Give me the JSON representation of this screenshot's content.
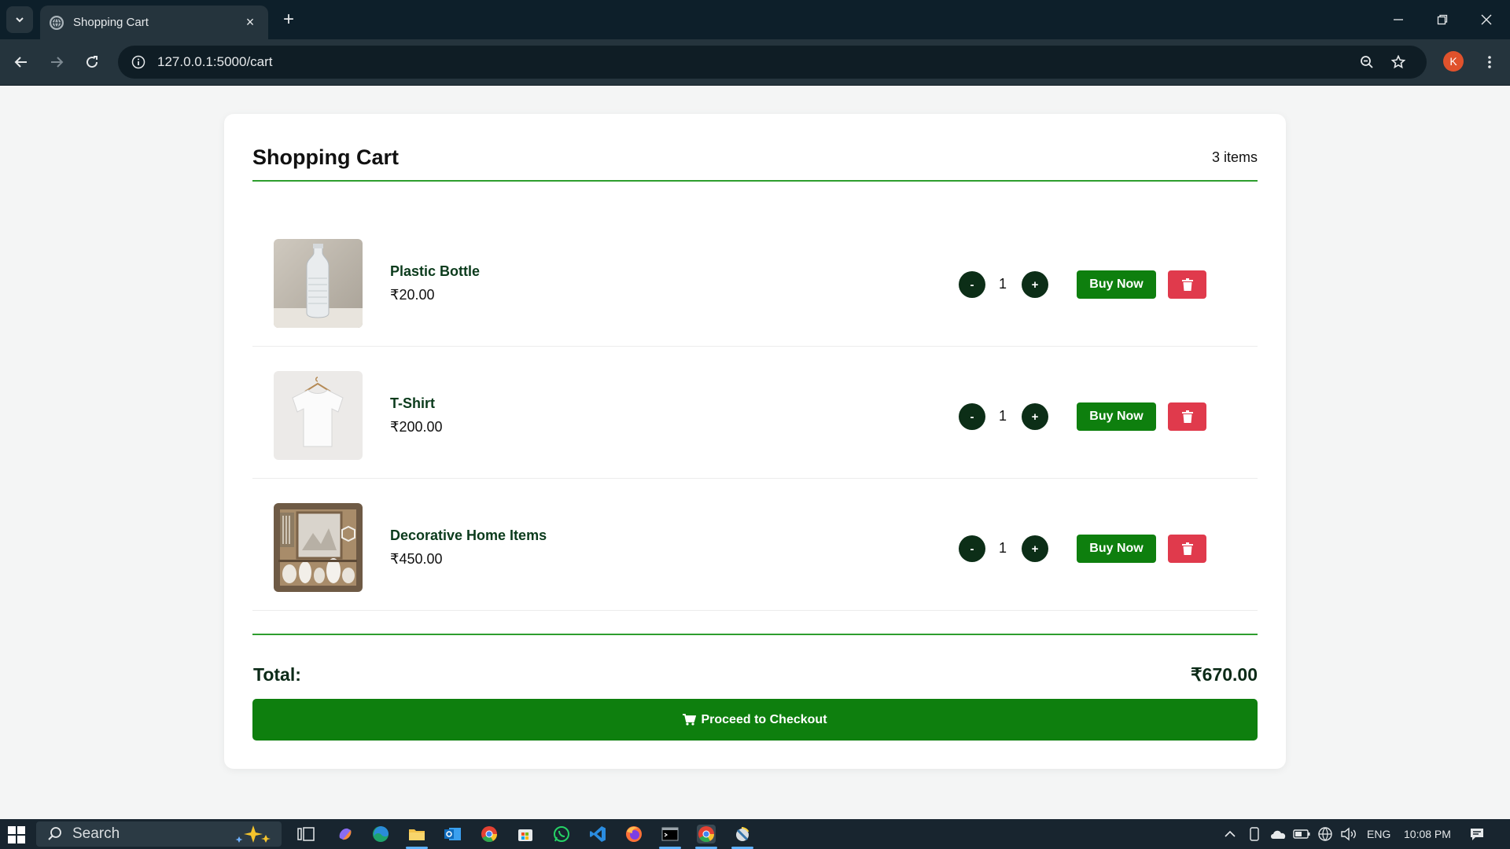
{
  "browser": {
    "tab_title": "Shopping Cart",
    "url": "127.0.0.1:5000/cart",
    "profile_initial": "K",
    "new_tab_label": "+",
    "close_tab_label": "×"
  },
  "cart": {
    "title": "Shopping Cart",
    "item_count": "3 items",
    "items": [
      {
        "name": "Plastic Bottle",
        "price": "₹20.00",
        "quantity": "1",
        "image": "plastic-bottle-photo"
      },
      {
        "name": "T-Shirt",
        "price": "₹200.00",
        "quantity": "1",
        "image": "white-tshirt-photo"
      },
      {
        "name": "Decorative Home Items",
        "price": "₹450.00",
        "quantity": "1",
        "image": "decor-shelf-photo"
      }
    ],
    "minus_label": "-",
    "plus_label": "+",
    "buy_label": "Buy Now",
    "total_label": "Total:",
    "total_value": "₹670.00",
    "checkout_label": "Proceed to Checkout"
  },
  "colors": {
    "brand_green": "#0e7f0e",
    "accent_line": "#2e9e2e",
    "delete_red": "#e03a4c",
    "qty_button": "#0c2e17"
  },
  "taskbar": {
    "search_placeholder": "Search",
    "language": "ENG",
    "time": "10:08 PM"
  }
}
